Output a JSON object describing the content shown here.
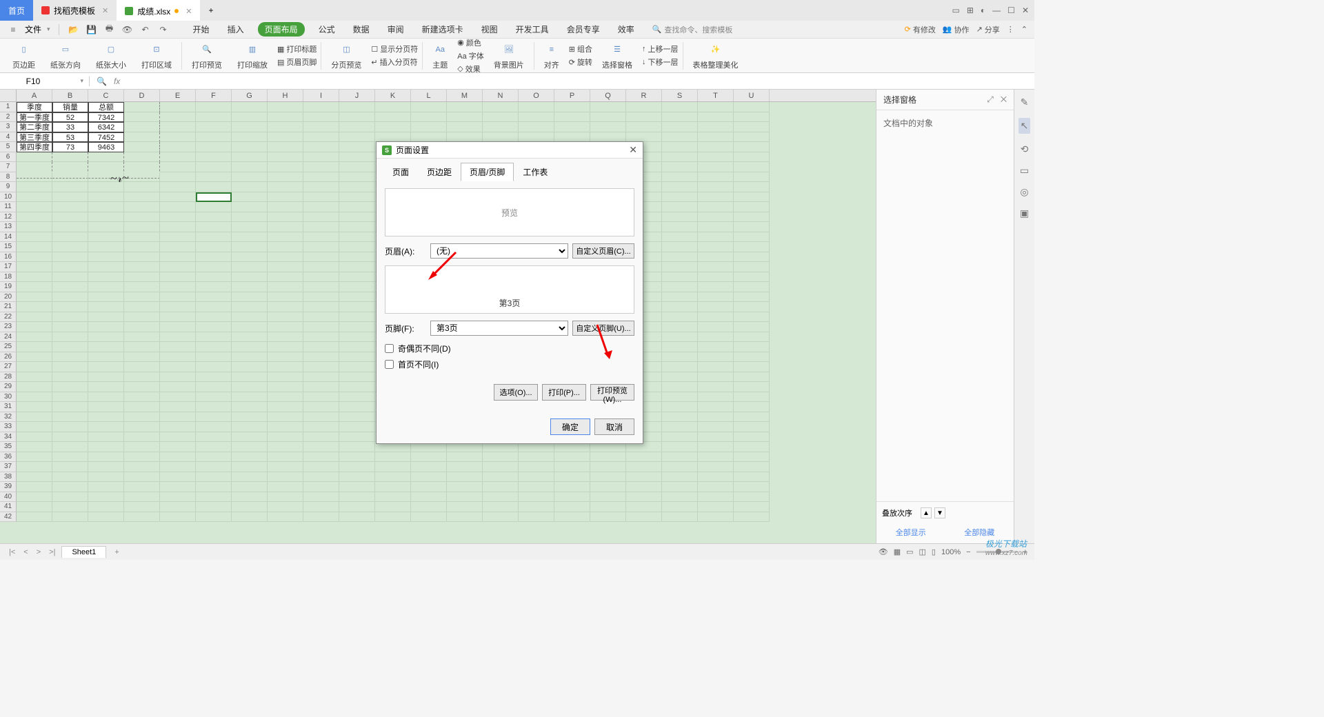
{
  "tabs": {
    "home": "首页",
    "template": "找稻壳模板",
    "file": "成绩.xlsx"
  },
  "menu": {
    "file": "文件",
    "items": [
      "开始",
      "插入",
      "页面布局",
      "公式",
      "数据",
      "审阅",
      "新建选项卡",
      "视图",
      "开发工具",
      "会员专享",
      "效率"
    ],
    "active": "页面布局",
    "search_icon": "Q",
    "search_placeholder": "查找命令、搜索模板"
  },
  "top_right": {
    "pending": "有修改",
    "coop": "协作",
    "share": "分享"
  },
  "ribbon": {
    "g1": "页边距",
    "g2": "纸张方向",
    "g3": "纸张大小",
    "g4": "打印区域",
    "g5": "打印预览",
    "g6": "打印缩放",
    "g7a": "打印标题",
    "g7b": "页眉页脚",
    "g8": "分页预览",
    "g9a": "显示分页符",
    "g9b": "插入分页符",
    "g10": "主题",
    "g11a": "颜色",
    "g11b": "Aa 字体",
    "g11c": "效果",
    "g12": "背景图片",
    "g13": "对齐",
    "g14a": "组合",
    "g14b": "旋转",
    "g15": "选择窗格",
    "g16a": "上移一层",
    "g16b": "下移一层",
    "g17": "表格整理美化"
  },
  "cell_ref": "F10",
  "fx": "fx",
  "table": {
    "headers": [
      "季度",
      "销量",
      "总额"
    ],
    "rows": [
      [
        "第一季度",
        "52",
        "7342"
      ],
      [
        "第二季度",
        "33",
        "6342"
      ],
      [
        "第三季度",
        "53",
        "7452"
      ],
      [
        "第四季度",
        "73",
        "9463"
      ]
    ]
  },
  "columns": [
    "A",
    "B",
    "C",
    "D",
    "E",
    "F",
    "G",
    "H",
    "I",
    "J",
    "K",
    "L",
    "M",
    "N",
    "O",
    "P",
    "Q",
    "R",
    "S",
    "T",
    "U"
  ],
  "side_panel": {
    "title": "选择窗格",
    "body": "文档中的对象",
    "stack": "叠放次序",
    "show_all": "全部显示",
    "hide_all": "全部隐藏"
  },
  "dialog": {
    "title": "页面设置",
    "tabs": [
      "页面",
      "页边距",
      "页眉/页脚",
      "工作表"
    ],
    "active_tab": "页眉/页脚",
    "preview_label": "预览",
    "header_label": "页眉(A):",
    "header_value": "(无)",
    "custom_header": "自定义页眉(C)...",
    "footer_preview": "第3页",
    "footer_label": "页脚(F):",
    "footer_value": "第3页",
    "custom_footer": "自定义页脚(U)...",
    "odd_even": "奇偶页不同(D)",
    "first_page": "首页不同(I)",
    "options": "选项(O)...",
    "print": "打印(P)...",
    "print_preview": "打印预览(W)...",
    "ok": "确定",
    "cancel": "取消"
  },
  "sheet": {
    "name": "Sheet1"
  },
  "status": {
    "zoom": "100%"
  },
  "watermark": {
    "name": "极光下载站",
    "url": "www.xz7.com"
  }
}
